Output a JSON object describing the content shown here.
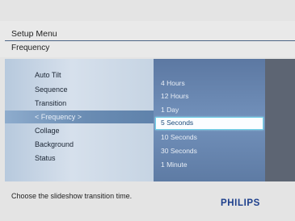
{
  "header": {
    "title": "Setup Menu",
    "subtitle": "Frequency"
  },
  "menu": {
    "items": [
      {
        "label": "Auto Tilt"
      },
      {
        "label": "Sequence"
      },
      {
        "label": "Transition"
      },
      {
        "label": "< Frequency >",
        "selected": true
      },
      {
        "label": "Collage"
      },
      {
        "label": "Background"
      },
      {
        "label": "Status"
      }
    ]
  },
  "options": {
    "items": [
      {
        "label": "4 Hours"
      },
      {
        "label": "12 Hours"
      },
      {
        "label": "1 Day"
      },
      {
        "label": "5 Seconds",
        "selected": true
      },
      {
        "label": "10 Seconds"
      },
      {
        "label": "30 Seconds"
      },
      {
        "label": "1 Minute"
      }
    ]
  },
  "footer": {
    "hint": "Choose the slideshow transition time.",
    "brand": "PHILIPS"
  },
  "colors": {
    "accent": "#6fd0e8",
    "brand": "#1d3f8c",
    "list_bg": "#6a88b3"
  }
}
